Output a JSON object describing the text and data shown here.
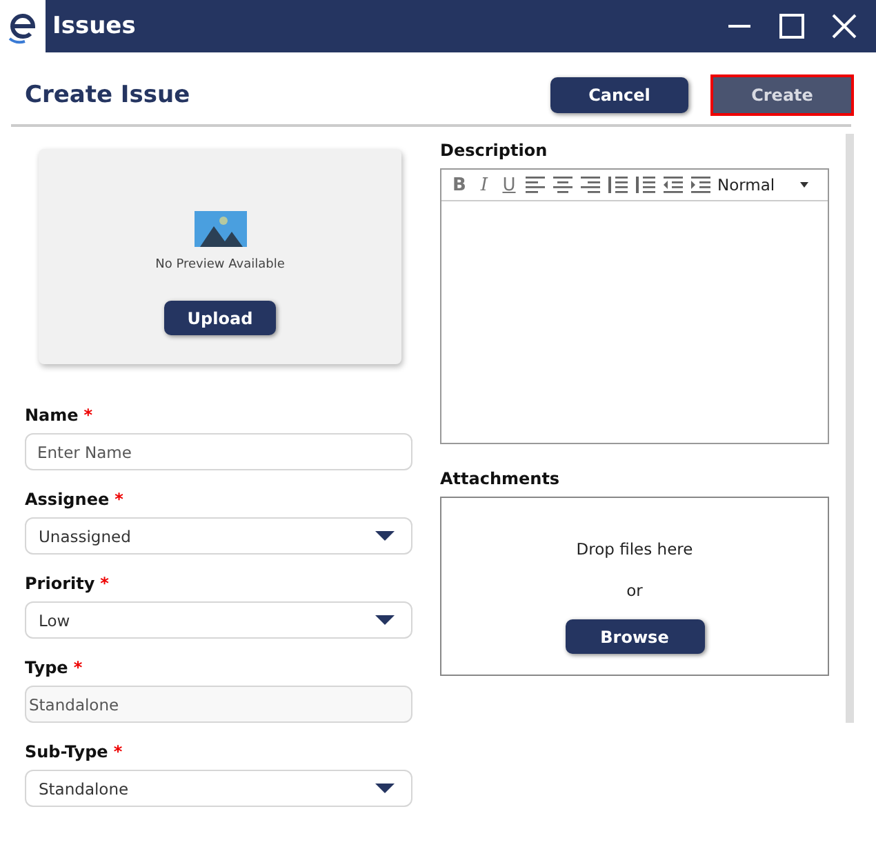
{
  "window": {
    "title": "Issues"
  },
  "header": {
    "title": "Create Issue",
    "buttons": [
      {
        "label": "Cancel",
        "disabled": false,
        "focused": false
      },
      {
        "label": "Create",
        "disabled": true,
        "focused": true
      }
    ]
  },
  "preview": {
    "caption": "No Preview Available",
    "button": "Upload"
  },
  "fields": [
    {
      "label": "Name",
      "required_mark": "*",
      "kind": "text",
      "placeholder": "Enter Name"
    },
    {
      "label": "Assignee",
      "required_mark": "*",
      "kind": "select",
      "value": "Unassigned"
    },
    {
      "label": "Priority",
      "required_mark": "*",
      "kind": "select",
      "value": "Low"
    },
    {
      "label": "Type",
      "required_mark": "*",
      "kind": "readonly",
      "value": "Standalone"
    },
    {
      "label": "Sub-Type",
      "required_mark": "*",
      "kind": "select",
      "value": "Standalone"
    }
  ],
  "description": {
    "label": "Description",
    "toolbar": [
      {
        "kind": "bold",
        "label": "B"
      },
      {
        "kind": "italic",
        "label": "I"
      },
      {
        "kind": "underline",
        "label": "U"
      },
      {
        "kind": "align-left"
      },
      {
        "kind": "align-center"
      },
      {
        "kind": "align-right"
      },
      {
        "kind": "ordered-list"
      },
      {
        "kind": "bullet-list"
      },
      {
        "kind": "outdent"
      },
      {
        "kind": "indent"
      }
    ],
    "format": "Normal"
  },
  "attachments": {
    "label": "Attachments",
    "drop_text": "Drop files here",
    "or_text": "or",
    "button": "Browse"
  }
}
